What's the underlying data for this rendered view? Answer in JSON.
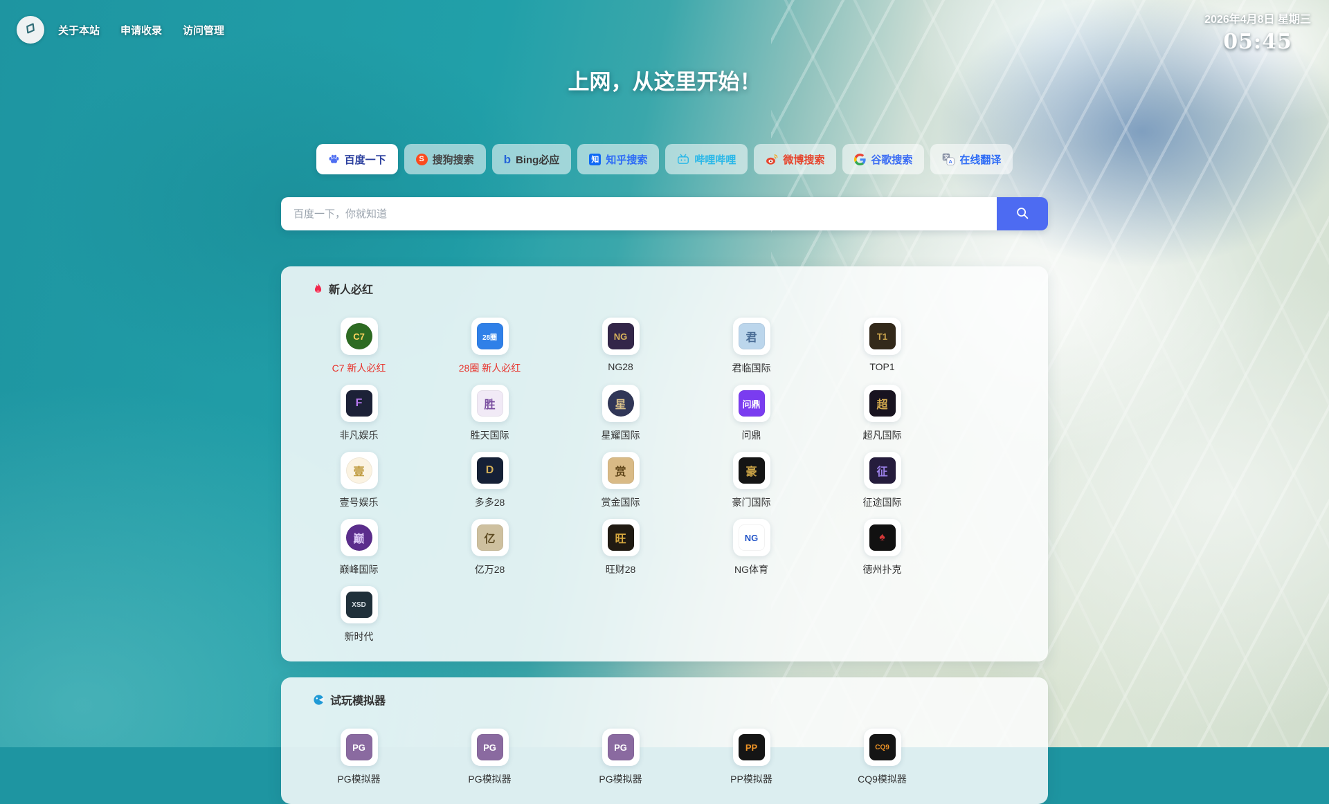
{
  "nav": {
    "links": [
      {
        "label": "关于本站"
      },
      {
        "label": "申请收录"
      },
      {
        "label": "访问管理"
      }
    ]
  },
  "datetime": {
    "date": "2026年4月8日 星期三",
    "time": "05:45"
  },
  "hero": {
    "title": "上网，从这里开始！"
  },
  "search": {
    "placeholder": "百度一下，你就知道",
    "button_color": "#4d6bf2",
    "engines": [
      {
        "label": "百度一下",
        "icon": "baidu-paw-icon",
        "color": "#2b3f9e",
        "active": true
      },
      {
        "label": "搜狗搜索",
        "icon": "sogou-icon",
        "color": "#454545",
        "active": false
      },
      {
        "label": "Bing必应",
        "icon": "bing-icon",
        "color": "#3a3a3a",
        "active": false
      },
      {
        "label": "知乎搜索",
        "icon": "zhihu-icon",
        "color": "#2e6cf6",
        "active": false
      },
      {
        "label": "哔哩哔哩",
        "icon": "bilibili-icon",
        "color": "#2ab8e8",
        "active": false
      },
      {
        "label": "微博搜索",
        "icon": "weibo-icon",
        "color": "#e6462e",
        "active": false
      },
      {
        "label": "谷歌搜索",
        "icon": "google-icon",
        "color": "#3a6cf4",
        "active": false
      },
      {
        "label": "在线翻译",
        "icon": "translate-icon",
        "color": "#2e6cf6",
        "active": false
      }
    ]
  },
  "sections": [
    {
      "id": "hot-sites",
      "title": "新人必红",
      "icon": "flame-icon",
      "items": [
        {
          "label": "C7 新人必红",
          "label_color": "#e8312a",
          "tile": {
            "text": "C7",
            "bg": "#2d6b22",
            "color": "#ffd45e",
            "shape": "circle"
          }
        },
        {
          "label": "28圈 新人必红",
          "label_color": "#e8312a",
          "tile": {
            "text": "28圈",
            "bg": "#2f80e8",
            "color": "#ffffff"
          }
        },
        {
          "label": "NG28",
          "tile": {
            "text": "NG",
            "bg": "#332649",
            "color": "#d9b35c"
          }
        },
        {
          "label": "君临国际",
          "tile": {
            "text": "君",
            "bg": "#bcd6ec",
            "color": "#4a6d96"
          }
        },
        {
          "label": "TOP1",
          "tile": {
            "text": "T1",
            "bg": "#33291a",
            "color": "#cda64d"
          }
        },
        {
          "label": "非凡娱乐",
          "tile": {
            "text": "F",
            "bg": "#1c2137",
            "color": "#b678ee"
          }
        },
        {
          "label": "胜天国际",
          "tile": {
            "text": "胜",
            "bg": "#f1eaf6",
            "color": "#7a4fa0"
          }
        },
        {
          "label": "星耀国际",
          "tile": {
            "text": "星",
            "bg": "#303657",
            "color": "#d8c08a",
            "shape": "circle"
          }
        },
        {
          "label": "问鼎",
          "tile": {
            "text": "问鼎",
            "bg": "#7a3cf0",
            "color": "#ffffff"
          }
        },
        {
          "label": "超凡国际",
          "tile": {
            "text": "超",
            "bg": "#181320",
            "color": "#d2a94e"
          }
        },
        {
          "label": "壹号娱乐",
          "tile": {
            "text": "壹",
            "bg": "#fbf3e2",
            "color": "#bf9a3d",
            "shape": "circle"
          }
        },
        {
          "label": "多多28",
          "tile": {
            "text": "D",
            "bg": "#152036",
            "color": "#d2ae58"
          }
        },
        {
          "label": "赏金国际",
          "tile": {
            "text": "赏",
            "bg": "#d9ba86",
            "color": "#5f4519"
          }
        },
        {
          "label": "豪门国际",
          "tile": {
            "text": "豪",
            "bg": "#151515",
            "color": "#cfa748"
          }
        },
        {
          "label": "征途国际",
          "tile": {
            "text": "征",
            "bg": "#251c3c",
            "color": "#9b80e8"
          }
        },
        {
          "label": "巅峰国际",
          "tile": {
            "text": "巅",
            "bg": "#5b2d8c",
            "color": "#dcc9f6",
            "shape": "circle"
          }
        },
        {
          "label": "亿万28",
          "tile": {
            "text": "亿",
            "bg": "#cec09f",
            "color": "#5d4a21"
          }
        },
        {
          "label": "旺财28",
          "tile": {
            "text": "旺",
            "bg": "#201a12",
            "color": "#d7a83e"
          }
        },
        {
          "label": "NG体育",
          "tile": {
            "text": "NG",
            "bg": "#ffffff",
            "color": "#2456c8"
          }
        },
        {
          "label": "德州扑克",
          "tile": {
            "text": "♠",
            "bg": "#111111",
            "color": "#d43838"
          }
        },
        {
          "label": "新时代",
          "tile": {
            "text": "XSD",
            "bg": "#20303a",
            "color": "#d6dee4"
          }
        }
      ]
    },
    {
      "id": "simulators",
      "title": "试玩模拟器",
      "icon": "game-icon",
      "items": [
        {
          "label": "PG模拟器",
          "tile": {
            "text": "PG",
            "bg": "#8a6aa0",
            "color": "#ffffff"
          }
        },
        {
          "label": "PG模拟器",
          "tile": {
            "text": "PG",
            "bg": "#8a6aa0",
            "color": "#ffffff"
          }
        },
        {
          "label": "PG模拟器",
          "tile": {
            "text": "PG",
            "bg": "#8a6aa0",
            "color": "#ffffff"
          }
        },
        {
          "label": "PP模拟器",
          "tile": {
            "text": "PP",
            "bg": "#151515",
            "color": "#ef9426"
          }
        },
        {
          "label": "CQ9模拟器",
          "tile": {
            "text": "CQ9",
            "bg": "#151515",
            "color": "#ef9426"
          }
        }
      ]
    }
  ]
}
